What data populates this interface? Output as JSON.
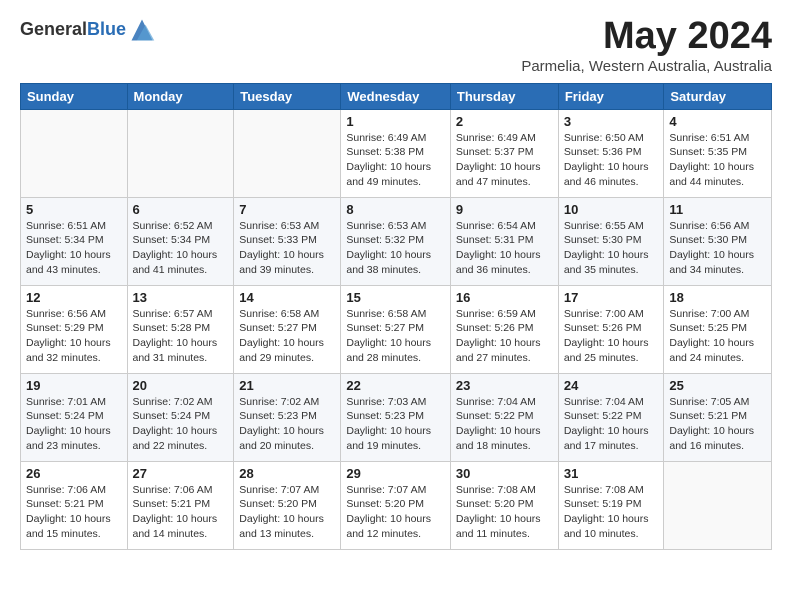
{
  "header": {
    "logo_line1": "General",
    "logo_line2": "Blue",
    "month_title": "May 2024",
    "subtitle": "Parmelia, Western Australia, Australia"
  },
  "weekdays": [
    "Sunday",
    "Monday",
    "Tuesday",
    "Wednesday",
    "Thursday",
    "Friday",
    "Saturday"
  ],
  "weeks": [
    [
      {
        "day": "",
        "info": ""
      },
      {
        "day": "",
        "info": ""
      },
      {
        "day": "",
        "info": ""
      },
      {
        "day": "1",
        "info": "Sunrise: 6:49 AM\nSunset: 5:38 PM\nDaylight: 10 hours\nand 49 minutes."
      },
      {
        "day": "2",
        "info": "Sunrise: 6:49 AM\nSunset: 5:37 PM\nDaylight: 10 hours\nand 47 minutes."
      },
      {
        "day": "3",
        "info": "Sunrise: 6:50 AM\nSunset: 5:36 PM\nDaylight: 10 hours\nand 46 minutes."
      },
      {
        "day": "4",
        "info": "Sunrise: 6:51 AM\nSunset: 5:35 PM\nDaylight: 10 hours\nand 44 minutes."
      }
    ],
    [
      {
        "day": "5",
        "info": "Sunrise: 6:51 AM\nSunset: 5:34 PM\nDaylight: 10 hours\nand 43 minutes."
      },
      {
        "day": "6",
        "info": "Sunrise: 6:52 AM\nSunset: 5:34 PM\nDaylight: 10 hours\nand 41 minutes."
      },
      {
        "day": "7",
        "info": "Sunrise: 6:53 AM\nSunset: 5:33 PM\nDaylight: 10 hours\nand 39 minutes."
      },
      {
        "day": "8",
        "info": "Sunrise: 6:53 AM\nSunset: 5:32 PM\nDaylight: 10 hours\nand 38 minutes."
      },
      {
        "day": "9",
        "info": "Sunrise: 6:54 AM\nSunset: 5:31 PM\nDaylight: 10 hours\nand 36 minutes."
      },
      {
        "day": "10",
        "info": "Sunrise: 6:55 AM\nSunset: 5:30 PM\nDaylight: 10 hours\nand 35 minutes."
      },
      {
        "day": "11",
        "info": "Sunrise: 6:56 AM\nSunset: 5:30 PM\nDaylight: 10 hours\nand 34 minutes."
      }
    ],
    [
      {
        "day": "12",
        "info": "Sunrise: 6:56 AM\nSunset: 5:29 PM\nDaylight: 10 hours\nand 32 minutes."
      },
      {
        "day": "13",
        "info": "Sunrise: 6:57 AM\nSunset: 5:28 PM\nDaylight: 10 hours\nand 31 minutes."
      },
      {
        "day": "14",
        "info": "Sunrise: 6:58 AM\nSunset: 5:27 PM\nDaylight: 10 hours\nand 29 minutes."
      },
      {
        "day": "15",
        "info": "Sunrise: 6:58 AM\nSunset: 5:27 PM\nDaylight: 10 hours\nand 28 minutes."
      },
      {
        "day": "16",
        "info": "Sunrise: 6:59 AM\nSunset: 5:26 PM\nDaylight: 10 hours\nand 27 minutes."
      },
      {
        "day": "17",
        "info": "Sunrise: 7:00 AM\nSunset: 5:26 PM\nDaylight: 10 hours\nand 25 minutes."
      },
      {
        "day": "18",
        "info": "Sunrise: 7:00 AM\nSunset: 5:25 PM\nDaylight: 10 hours\nand 24 minutes."
      }
    ],
    [
      {
        "day": "19",
        "info": "Sunrise: 7:01 AM\nSunset: 5:24 PM\nDaylight: 10 hours\nand 23 minutes."
      },
      {
        "day": "20",
        "info": "Sunrise: 7:02 AM\nSunset: 5:24 PM\nDaylight: 10 hours\nand 22 minutes."
      },
      {
        "day": "21",
        "info": "Sunrise: 7:02 AM\nSunset: 5:23 PM\nDaylight: 10 hours\nand 20 minutes."
      },
      {
        "day": "22",
        "info": "Sunrise: 7:03 AM\nSunset: 5:23 PM\nDaylight: 10 hours\nand 19 minutes."
      },
      {
        "day": "23",
        "info": "Sunrise: 7:04 AM\nSunset: 5:22 PM\nDaylight: 10 hours\nand 18 minutes."
      },
      {
        "day": "24",
        "info": "Sunrise: 7:04 AM\nSunset: 5:22 PM\nDaylight: 10 hours\nand 17 minutes."
      },
      {
        "day": "25",
        "info": "Sunrise: 7:05 AM\nSunset: 5:21 PM\nDaylight: 10 hours\nand 16 minutes."
      }
    ],
    [
      {
        "day": "26",
        "info": "Sunrise: 7:06 AM\nSunset: 5:21 PM\nDaylight: 10 hours\nand 15 minutes."
      },
      {
        "day": "27",
        "info": "Sunrise: 7:06 AM\nSunset: 5:21 PM\nDaylight: 10 hours\nand 14 minutes."
      },
      {
        "day": "28",
        "info": "Sunrise: 7:07 AM\nSunset: 5:20 PM\nDaylight: 10 hours\nand 13 minutes."
      },
      {
        "day": "29",
        "info": "Sunrise: 7:07 AM\nSunset: 5:20 PM\nDaylight: 10 hours\nand 12 minutes."
      },
      {
        "day": "30",
        "info": "Sunrise: 7:08 AM\nSunset: 5:20 PM\nDaylight: 10 hours\nand 11 minutes."
      },
      {
        "day": "31",
        "info": "Sunrise: 7:08 AM\nSunset: 5:19 PM\nDaylight: 10 hours\nand 10 minutes."
      },
      {
        "day": "",
        "info": ""
      }
    ]
  ]
}
